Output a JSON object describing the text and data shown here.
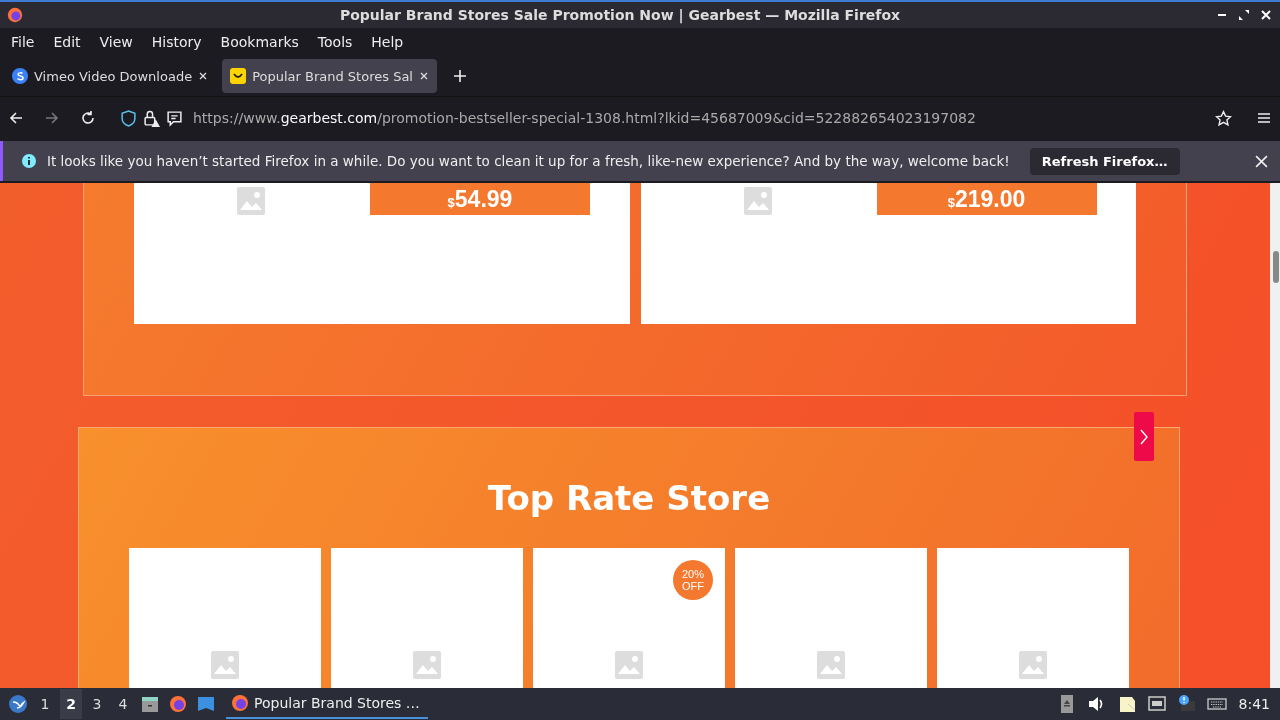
{
  "window": {
    "title": "Popular Brand Stores Sale Promotion Now | Gearbest — Mozilla Firefox"
  },
  "menu": [
    "File",
    "Edit",
    "View",
    "History",
    "Bookmarks",
    "Tools",
    "Help"
  ],
  "tabs": [
    {
      "label": "Vimeo Video Downloade",
      "selected": false
    },
    {
      "label": "Popular Brand Stores Sal",
      "selected": true
    }
  ],
  "address": {
    "domain_pre": "https://www.",
    "domain": "gearbest.com",
    "path": "/promotion-bestseller-special-1308.html?lkid=45687009&cid=522882654023197082"
  },
  "notification": {
    "message": "It looks like you haven’t started Firefox in a while. Do you want to clean it up for a fresh, like-new experience? And by the way, welcome back!",
    "button": "Refresh Firefox…"
  },
  "products": [
    {
      "currency": "$",
      "price": "54.99"
    },
    {
      "currency": "$",
      "price": "219.00"
    }
  ],
  "top_rate": {
    "title": "Top Rate Store",
    "stores": [
      {
        "kind": "plain"
      },
      {
        "kind": "plain"
      },
      {
        "kind": "discount",
        "badge": "20% OFF"
      },
      {
        "kind": "plain"
      },
      {
        "kind": "plain"
      }
    ]
  },
  "taskbar": {
    "workspaces": [
      {
        "label": "1",
        "selected": false
      },
      {
        "label": "2",
        "selected": true
      },
      {
        "label": "3",
        "selected": false
      },
      {
        "label": "4",
        "selected": false
      }
    ],
    "task": "Popular Brand Stores …",
    "clock": "8:41"
  }
}
